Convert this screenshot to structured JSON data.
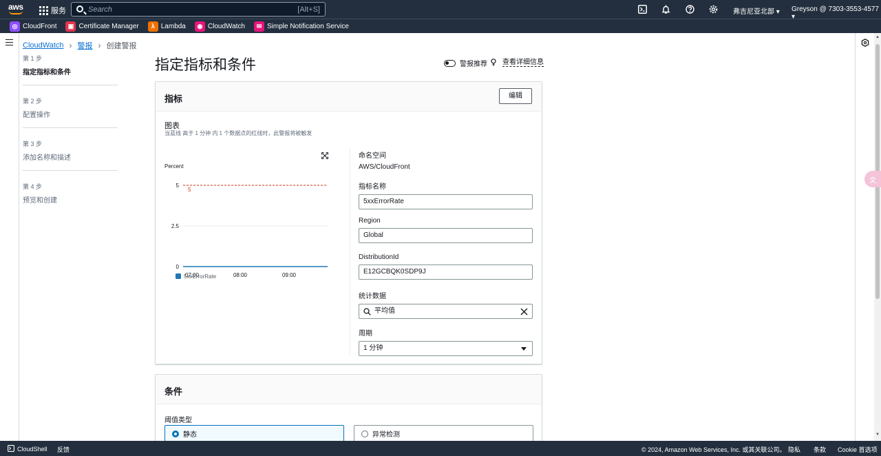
{
  "topnav": {
    "logo_text": "aws",
    "services_label": "服务",
    "search_placeholder": "Search",
    "search_shortcut": "[Alt+S]",
    "region": "弗吉尼亚北部 ▾",
    "account": "Greyson @ 7303-3553-4577 ▾"
  },
  "favorites": [
    {
      "label": "CloudFront",
      "color": "#8c4fff",
      "icon": "cloudfront-icon"
    },
    {
      "label": "Certificate Manager",
      "color": "#dd344c",
      "icon": "certificate-manager-icon"
    },
    {
      "label": "Lambda",
      "color": "#ed7100",
      "icon": "lambda-icon"
    },
    {
      "label": "CloudWatch",
      "color": "#e7157b",
      "icon": "cloudwatch-icon"
    },
    {
      "label": "Simple Notification Service",
      "color": "#e7157b",
      "icon": "sns-icon"
    }
  ],
  "breadcrumb": {
    "item1": "CloudWatch",
    "item2": "警报",
    "current": "创建警报"
  },
  "steps": [
    {
      "num": "第 1 步",
      "title": "指定指标和条件"
    },
    {
      "num": "第 2 步",
      "title": "配置操作"
    },
    {
      "num": "第 3 步",
      "title": "添加名称和描述"
    },
    {
      "num": "第 4 步",
      "title": "预览和创建"
    }
  ],
  "page_title": "指定指标和条件",
  "alarm_recommendations": "警报推荐",
  "view_details": "查看详细信息",
  "metric_panel": {
    "title": "指标",
    "edit": "编辑",
    "chart_label": "图表",
    "chart_desc": "当蓝线 高于 1 分钟 内 1 个数据点的红线时，此警报将被触发"
  },
  "chart_data": {
    "type": "line",
    "ylabel": "Percent",
    "yticks": [
      "0",
      "2.5",
      "5"
    ],
    "ylim": [
      0,
      5
    ],
    "xticks": [
      "07:00",
      "08:00",
      "09:00"
    ],
    "series": [
      {
        "name": "5xxErrorRate",
        "values": [
          0,
          0,
          0,
          0
        ],
        "color": "#1f77b4"
      }
    ],
    "threshold": {
      "value": 5,
      "label": "5",
      "color": "#d13212"
    },
    "legend": "bottom-left"
  },
  "fields": {
    "namespace_label": "命名空间",
    "namespace_value": "AWS/CloudFront",
    "metric_name_label": "指标名称",
    "metric_name_value": "5xxErrorRate",
    "region_label": "Region",
    "region_value": "Global",
    "distribution_label": "DistributionId",
    "distribution_value": "E12GCBQK0SDP9J",
    "statistic_label": "统计数据",
    "statistic_value": "平均值",
    "period_label": "周期",
    "period_value": "1 分钟"
  },
  "conditions_panel": {
    "title": "条件",
    "threshold_type_label": "阈值类型",
    "static": "静态",
    "anomaly": "异常检测"
  },
  "footer": {
    "cloudshell": "CloudShell",
    "feedback": "反馈",
    "copyright": "© 2024, Amazon Web Services, Inc. 或其关联公司。",
    "privacy": "隐私",
    "terms": "条款",
    "cookie": "Cookie 首选项"
  }
}
